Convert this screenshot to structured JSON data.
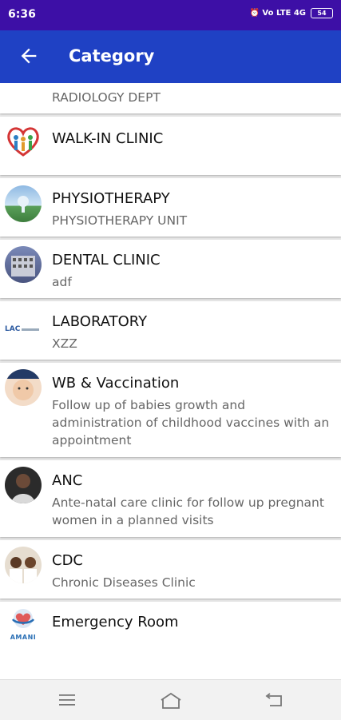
{
  "status_bar": {
    "time": "6:36",
    "carrier_icons": "⏰ Vo LTE 4G",
    "battery": "54"
  },
  "app_bar": {
    "title": "Category"
  },
  "categories": [
    {
      "name": "",
      "description": "RADIOLOGY DEPT"
    },
    {
      "name": "WALK-IN CLINIC",
      "description": ""
    },
    {
      "name": "PHYSIOTHERAPY",
      "description": "PHYSIOTHERAPY UNIT"
    },
    {
      "name": "DENTAL CLINIC",
      "description": "adf"
    },
    {
      "name": "LABORATORY",
      "description": "XZZ"
    },
    {
      "name": "WB & Vaccination",
      "description": "Follow up of babies growth and administration of childhood vaccines with an appointment"
    },
    {
      "name": "ANC",
      "description": "Ante-natal care clinic for follow up pregnant women in a planned visits"
    },
    {
      "name": "CDC",
      "description": "Chronic Diseases Clinic"
    },
    {
      "name": "Emergency Room",
      "description": ""
    }
  ],
  "logos": {
    "lab_text": "LAC",
    "amani_text": "AMANI"
  }
}
